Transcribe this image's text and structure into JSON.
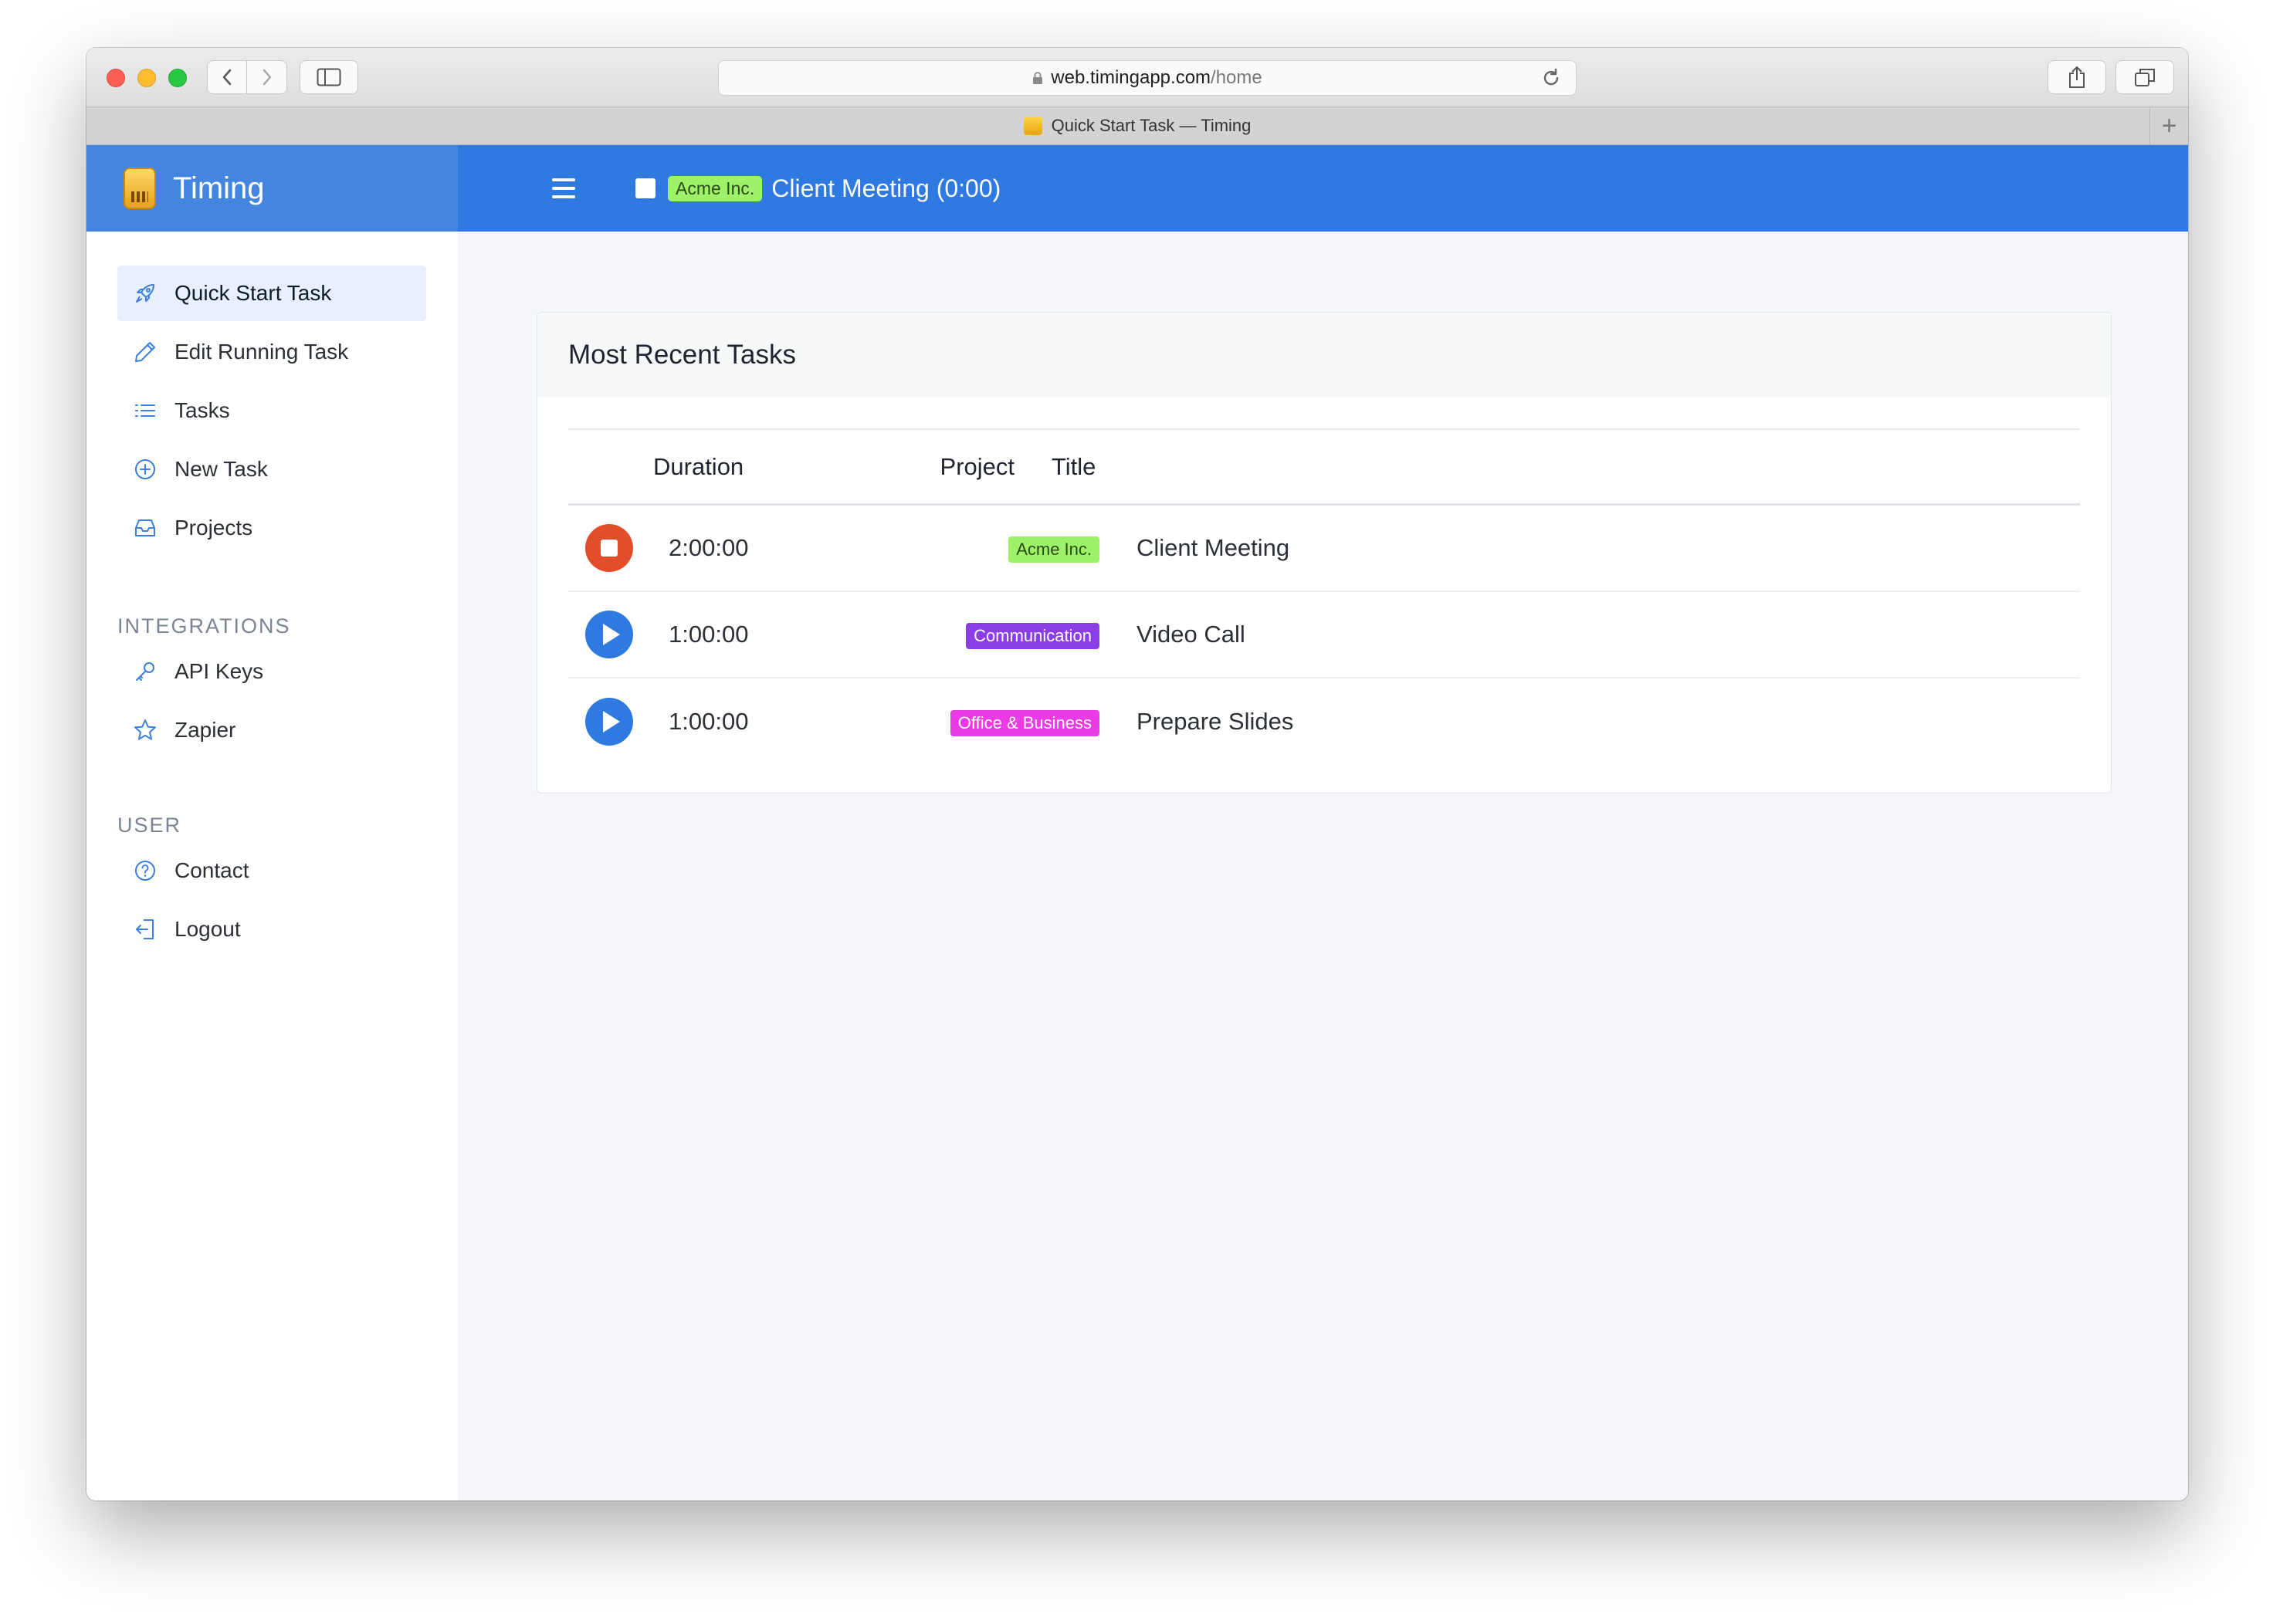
{
  "browser": {
    "url_host": "web.timingapp.com",
    "url_path": "/home",
    "tab_title": "Quick Start Task — Timing",
    "new_tab_glyph": "+"
  },
  "app": {
    "brand": "Timing",
    "running_task": {
      "project": "Acme Inc.",
      "label": "Client Meeting (0:00)"
    }
  },
  "sidebar": {
    "items": [
      {
        "label": "Quick Start Task",
        "icon": "rocket-icon",
        "active": true
      },
      {
        "label": "Edit Running Task",
        "icon": "pencil-icon"
      },
      {
        "label": "Tasks",
        "icon": "list-icon"
      },
      {
        "label": "New Task",
        "icon": "plus-circle-icon"
      },
      {
        "label": "Projects",
        "icon": "inbox-icon"
      }
    ],
    "integrations_label": "INTEGRATIONS",
    "integrations": [
      {
        "label": "API Keys",
        "icon": "key-icon"
      },
      {
        "label": "Zapier",
        "icon": "star-icon"
      }
    ],
    "user_label": "USER",
    "user": [
      {
        "label": "Contact",
        "icon": "help-circle-icon"
      },
      {
        "label": "Logout",
        "icon": "logout-icon"
      }
    ]
  },
  "main": {
    "card_title": "Most Recent Tasks",
    "columns": {
      "duration": "Duration",
      "project": "Project",
      "title": "Title"
    },
    "rows": [
      {
        "action": "stop",
        "duration": "2:00:00",
        "project": "Acme Inc.",
        "project_color": "#9ef26a",
        "title": "Client Meeting"
      },
      {
        "action": "play",
        "duration": "1:00:00",
        "project": "Communication",
        "project_color": "#8b3ee8",
        "title": "Video Call"
      },
      {
        "action": "play",
        "duration": "1:00:00",
        "project": "Office & Business",
        "project_color": "#ea3be6",
        "title": "Prepare Slides"
      }
    ]
  },
  "colors": {
    "accent": "#2f7ae0",
    "brand_bg": "#4385e0",
    "stop": "#e24e2a"
  }
}
